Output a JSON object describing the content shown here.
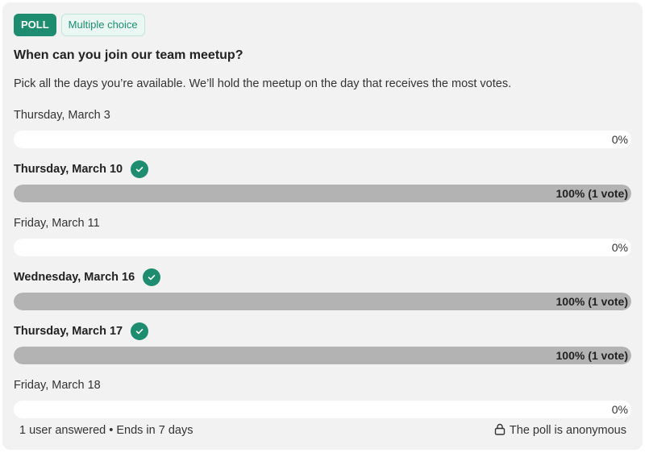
{
  "badges": {
    "poll": "POLL",
    "type": "Multiple choice"
  },
  "poll": {
    "question": "When can you join our team meetup?",
    "description": "Pick all the days you’re available. We’ll hold the meetup on the day that receives the most votes.",
    "options": [
      {
        "label": "Thursday, March 3",
        "result": "0%",
        "percent": 0,
        "voted": false
      },
      {
        "label": "Thursday, March 10",
        "result": "100% (1 vote)",
        "percent": 100,
        "voted": true
      },
      {
        "label": "Friday, March 11",
        "result": "0%",
        "percent": 0,
        "voted": false
      },
      {
        "label": "Wednesday, March 16",
        "result": "100% (1 vote)",
        "percent": 100,
        "voted": true
      },
      {
        "label": "Thursday, March 17",
        "result": "100% (1 vote)",
        "percent": 100,
        "voted": true
      },
      {
        "label": "Friday, March 18",
        "result": "0%",
        "percent": 0,
        "voted": false
      }
    ]
  },
  "footer": {
    "summary": "1 user answered • Ends in 7 days",
    "anonymous": "The poll is anonymous"
  },
  "icons": {
    "check": "check-icon",
    "lock": "lock-icon"
  },
  "colors": {
    "accent": "#1e8c6e",
    "bar_fill": "#b3b3b3",
    "bar_track": "#ffffff",
    "card_bg": "#f2f2f2"
  }
}
